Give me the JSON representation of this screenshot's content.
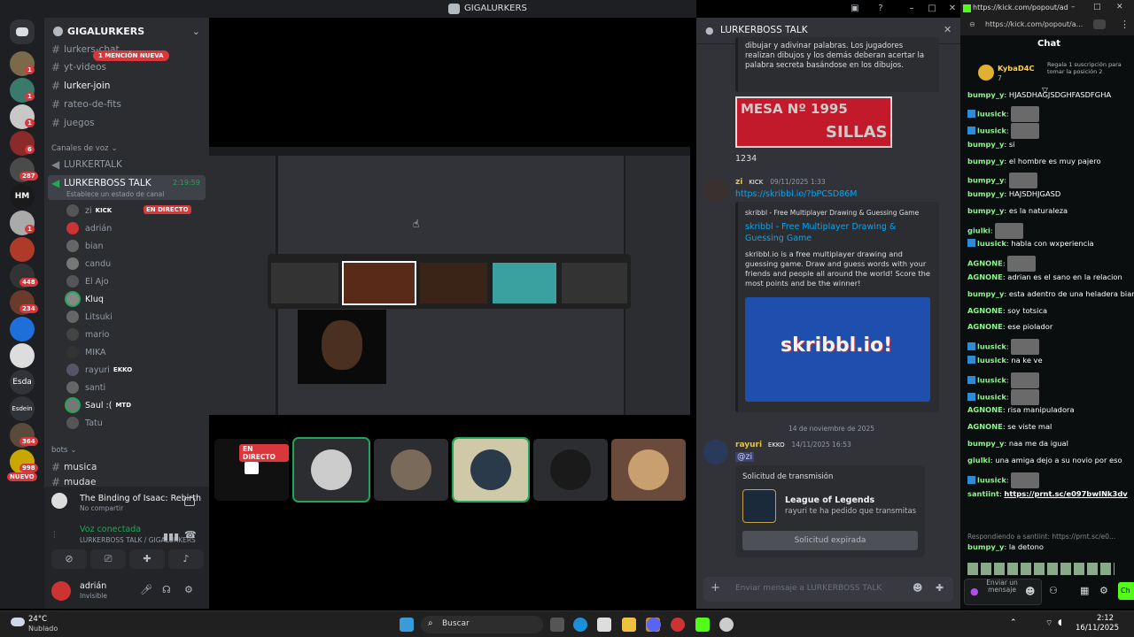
{
  "discord": {
    "window_title": "GIGALURKERS",
    "server_name": "GIGALURKERS",
    "channels": {
      "lurkers_chat": "lurkers-chat",
      "mention_badge": "1 MENCIÓN NUEVA",
      "yt_videos": "yt-videos",
      "lurker_join": "lurker-join",
      "rateo": "rateo-de-fits",
      "juegos": "juegos",
      "voice_category": "Canales de voz",
      "lurkertalk": "LURKERTALK",
      "lurkerboss": "LURKERBOSS TALK",
      "lurkerboss_time": "2:19:59",
      "lurkerboss_status": "Establece un estado de canal",
      "bots_category": "bots",
      "musica": "musica",
      "mudae": "mudae"
    },
    "members": [
      {
        "name": "zi",
        "tag": "KICK",
        "live": "EN DIRECTO"
      },
      {
        "name": "adrián"
      },
      {
        "name": "bian"
      },
      {
        "name": "candu"
      },
      {
        "name": "El Ajo"
      },
      {
        "name": "Kluq"
      },
      {
        "name": "Litsuki"
      },
      {
        "name": "mario"
      },
      {
        "name": "MIKA"
      },
      {
        "name": "rayuri",
        "tag": "EKKO"
      },
      {
        "name": "santi"
      },
      {
        "name": "Saul :(",
        "tag": "MTD"
      },
      {
        "name": "Tatu"
      }
    ],
    "server_badges": [
      "1",
      "1",
      "1",
      "6",
      "287",
      "HM",
      "1",
      "448",
      "234",
      "Esda",
      "Esdein",
      "364",
      "998",
      "NUEVO"
    ],
    "activity": {
      "game": "The Binding of Isaac: Rebirth",
      "sub": "No compartir"
    },
    "voice": {
      "status": "Voz conectada",
      "location": "LURKERBOSS TALK / GIGALURKERS"
    },
    "user": {
      "name": "adrián",
      "status": "Invisible"
    },
    "stream_live_badge": "EN DIRECTO"
  },
  "textchat": {
    "title": "LURKERBOSS TALK",
    "embed1_text": "dibujar y adivinar palabras. Los jugadores realizan dibujos y los demás deberan acertar la palabra secreta basándose en los dibujos.",
    "sign_line1": "MESA Nº 1995",
    "sign_line2": "SILLAS",
    "msg_1234": "1234",
    "zi_name": "zi",
    "zi_tag": "KICK",
    "zi_time": "09/11/2025 1:33",
    "zi_link": "https://skribbl.io/?bPCSD86M",
    "embed_site": "skribbl - Free Multiplayer Drawing & Guessing Game",
    "embed_title": "skribbl - Free Multiplayer Drawing & Guessing Game",
    "embed_desc": "skribbl.io is a free multiplayer drawing and guessing game. Draw and guess words with your friends and people all around the world! Score the most points and be the winner!",
    "embed_logo": "skribbl.io!",
    "date_divider": "14 de noviembre de 2025",
    "rayuri_name": "rayuri",
    "rayuri_tag": "EKKO",
    "rayuri_time": "14/11/2025 16:53",
    "rayuri_mention": "@zi",
    "request_header": "Solicitud de transmisión",
    "request_game": "League of Legends",
    "request_text": "rayuri te ha pedido que transmitas",
    "request_button": "Solicitud expirada",
    "input_placeholder": "Enviar mensaje a LURKERBOSS TALK"
  },
  "kick": {
    "url": "https://kick.com/popout/adrianmt...",
    "address": "https://kick.com/popout/a...",
    "chat_title": "Chat",
    "gift_user": "KybaD4C",
    "gift_count": "7",
    "gift_text": "Regala 1 suscripción para tomar la posición 2",
    "messages": [
      {
        "user": "bumpy_y",
        "text": "HJASDHAGJSDGHFASDFGHA"
      },
      {
        "user": "luusick",
        "text": ""
      },
      {
        "user": "luusick",
        "text": ""
      },
      {
        "user": "bumpy_y",
        "text": "si"
      },
      {
        "user": "bumpy_y",
        "text": "el hombre es muy pajero"
      },
      {
        "user": "bumpy_y",
        "text": ""
      },
      {
        "user": "bumpy_y",
        "text": "HAJSDHJGASD"
      },
      {
        "user": "bumpy_y",
        "text": "es la naturaleza"
      },
      {
        "user": "giulki",
        "text": ""
      },
      {
        "user": "luusick",
        "text": "habla con wxperiencia"
      },
      {
        "user": "AGNONE",
        "text": ""
      },
      {
        "user": "AGNONE",
        "text": "adrian es el sano en la relacion"
      },
      {
        "user": "bumpy_y",
        "text": "esta adentro de una heladera bian"
      },
      {
        "user": "AGNONE",
        "text": "soy totsica"
      },
      {
        "user": "AGNONE",
        "text": "ese piolador"
      },
      {
        "user": "luusick",
        "text": ""
      },
      {
        "user": "luusick",
        "text": "na ke ve"
      },
      {
        "user": "luusick",
        "text": ""
      },
      {
        "user": "luusick",
        "text": ""
      },
      {
        "user": "AGNONE",
        "text": "risa manipuladora"
      },
      {
        "user": "AGNONE",
        "text": "se viste mal"
      },
      {
        "user": "bumpy_y",
        "text": "naa me da igual"
      },
      {
        "user": "giulki",
        "text": "una amiga dejo a su novio por eso"
      },
      {
        "user": "luusick",
        "text": ""
      },
      {
        "user": "santiint",
        "text": "https://prnt.sc/e097bwINk3dv"
      }
    ],
    "reply_hint": "Respondiendo a santiint: https://prnt.sc/e0...",
    "last_msg_user": "bumpy_y",
    "last_msg_text": "la detono",
    "send_label": "Enviar un mensaje",
    "chat_button": "Ch"
  },
  "taskbar": {
    "weather_temp": "24°C",
    "weather_desc": "Nublado",
    "search": "Buscar",
    "time": "2:12",
    "date": "16/11/2025"
  }
}
